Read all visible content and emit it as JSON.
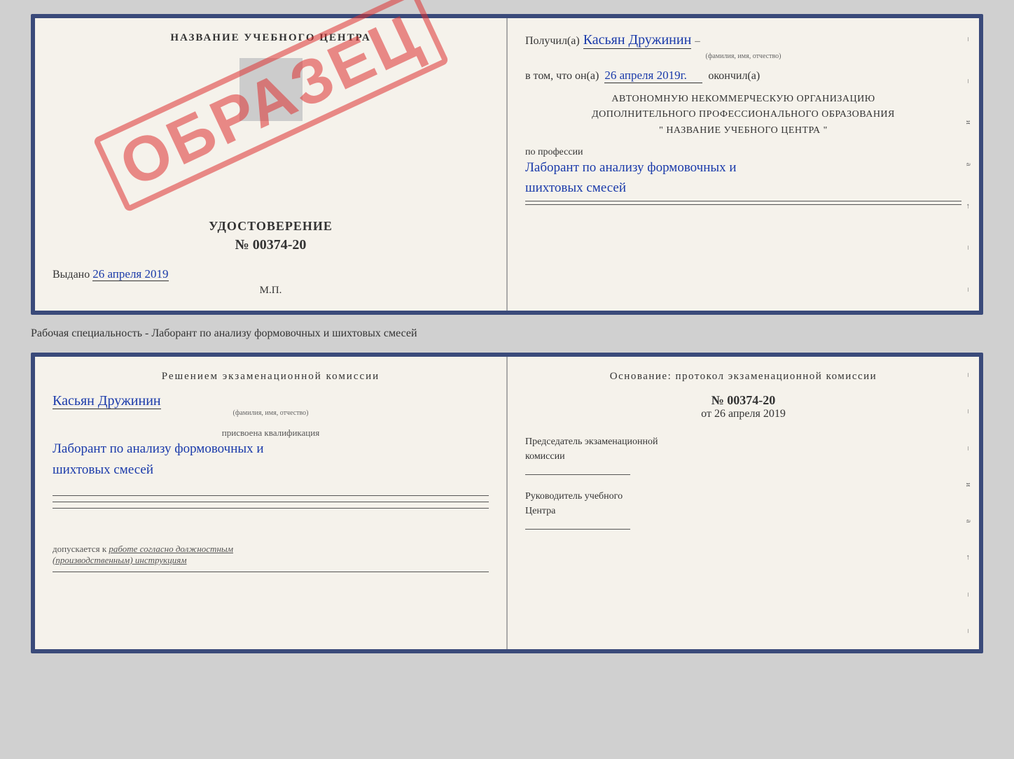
{
  "top_cert": {
    "left": {
      "title": "НАЗВАНИЕ УЧЕБНОГО ЦЕНТРА",
      "stamp": "ОБРАЗЕЦ",
      "udostoverenie_label": "УДОСТОВЕРЕНИЕ",
      "number": "№ 00374-20",
      "vydano_label": "Выдано",
      "vydano_date": "26 апреля 2019",
      "mp": "М.П."
    },
    "right": {
      "poluchil_prefix": "Получил(а)",
      "fio": "Касьян Дружинин",
      "fio_subtitle": "(фамилия, имя, отчество)",
      "vtom_prefix": "в том, что он(а)",
      "date": "26 апреля 2019г.",
      "okonchil": "окончил(а)",
      "org_line1": "АВТОНОМНУЮ НЕКОММЕРЧЕСКУЮ ОРГАНИЗАЦИЮ",
      "org_line2": "ДОПОЛНИТЕЛЬНОГО ПРОФЕССИОНАЛЬНОГО ОБРАЗОВАНИЯ",
      "org_line3": "\"   НАЗВАНИЕ УЧЕБНОГО ЦЕНТРА   \"",
      "po_professii": "по профессии",
      "prof_handwritten": "Лаборант по анализу формовочных и",
      "prof_handwritten2": "шихтовых смесей"
    }
  },
  "specialty_line": "Рабочая специальность - Лаборант по анализу формовочных и шихтовых смесей",
  "bottom_cert": {
    "left": {
      "resheniyem": "Решением экзаменационной комиссии",
      "fio": "Касьян Дружинин",
      "fio_subtitle": "(фамилия, имя, отчество)",
      "prisvoyena": "присвоена квалификация",
      "kvali_line1": "Лаборант по анализу формовочных и",
      "kvali_line2": "шихтовых смесей",
      "dopuskaetsya_prefix": "допускается к",
      "dopuskaetsya_main": "работе согласно должностным",
      "dopuskaetsya_main2": "(производственным) инструкциям"
    },
    "right": {
      "osnovanie": "Основание: протокол экзаменационной комиссии",
      "number": "№ 00374-20",
      "ot": "от",
      "date": "26 апреля 2019",
      "predsedatel_label": "Председатель экзаменационной",
      "predsedatel_label2": "комиссии",
      "rukovoditel_label": "Руководитель учебного",
      "rukovoditel_label2": "Центра"
    }
  }
}
